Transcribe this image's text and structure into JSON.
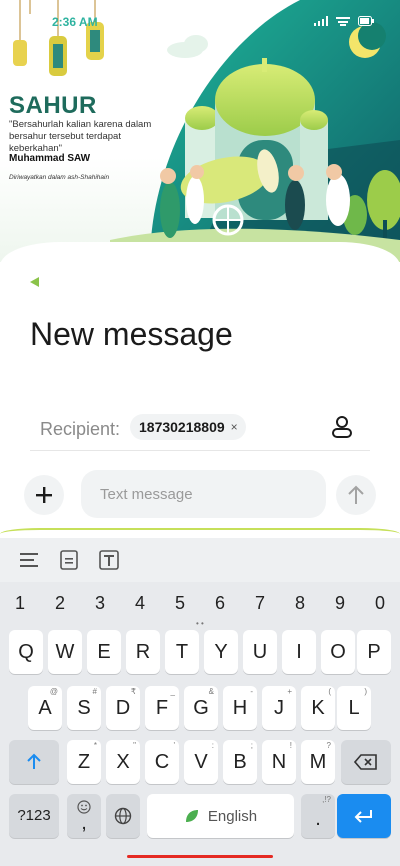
{
  "status_bar": {
    "time": "2:36 AM"
  },
  "banner": {
    "title": "SAHUR",
    "quote": "\"Bersahurlah kalian karena dalam bersahur tersebut terdapat keberkahan\"",
    "author": "Muhammad SAW",
    "source": "Diriwayatkan dalam ash-Shahihain"
  },
  "compose": {
    "title": "New message",
    "recipient_label": "Recipient:",
    "recipient": "18730218809",
    "chip_remove": "×",
    "message_placeholder": "Text message"
  },
  "keyboard": {
    "numbers": [
      "1",
      "2",
      "3",
      "4",
      "5",
      "6",
      "7",
      "8",
      "9",
      "0"
    ],
    "row1": [
      "Q",
      "W",
      "E",
      "R",
      "T",
      "Y",
      "U",
      "I",
      "O",
      "P"
    ],
    "row2": [
      "A",
      "S",
      "D",
      "F",
      "G",
      "H",
      "J",
      "K",
      "L"
    ],
    "row2_hints": [
      "@",
      "#",
      "₹",
      "_",
      "&",
      "-",
      "+",
      "(",
      ")"
    ],
    "row3": [
      "Z",
      "X",
      "C",
      "V",
      "B",
      "N",
      "M"
    ],
    "row3_hints": [
      "*",
      "\"",
      "'",
      ":",
      ";",
      "!",
      "?"
    ],
    "symbols_label": "?123",
    "comma": ",",
    "space_label": "English",
    "period": ".",
    "period_hint": ",!?"
  },
  "colors": {
    "accent": "#8bc34a",
    "enter_key": "#1a8cf0",
    "nav_bar": "#e52a23",
    "brand_teal": "#1e6b5c"
  }
}
